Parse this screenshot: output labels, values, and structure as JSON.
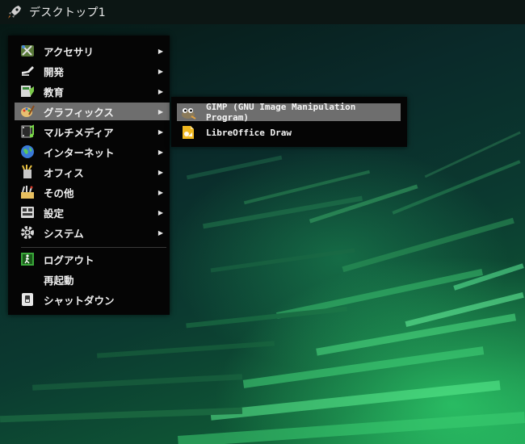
{
  "topbar": {
    "title": "デスクトップ1",
    "icon": "rocket-icon"
  },
  "menu": {
    "items": [
      {
        "label": "アクセサリ",
        "icon": "accessories-icon",
        "arrow": "▶"
      },
      {
        "label": "開発",
        "icon": "development-icon",
        "arrow": "▶"
      },
      {
        "label": "教育",
        "icon": "education-icon",
        "arrow": "▶"
      },
      {
        "label": "グラフィックス",
        "icon": "graphics-icon",
        "arrow": "▶"
      },
      {
        "label": "マルチメディア",
        "icon": "multimedia-icon",
        "arrow": "▶"
      },
      {
        "label": "インターネット",
        "icon": "internet-icon",
        "arrow": "▶"
      },
      {
        "label": "オフィス",
        "icon": "office-icon",
        "arrow": "▶"
      },
      {
        "label": "その他",
        "icon": "other-icon",
        "arrow": "▶"
      },
      {
        "label": "設定",
        "icon": "settings-icon",
        "arrow": "▶"
      },
      {
        "label": "システム",
        "icon": "system-icon",
        "arrow": "▶"
      }
    ],
    "session": [
      {
        "label": "ログアウト",
        "icon": "logout-icon"
      },
      {
        "label": "再起動",
        "icon": ""
      },
      {
        "label": "シャットダウン",
        "icon": "shutdown-icon"
      }
    ]
  },
  "submenu": {
    "items": [
      {
        "label": "GIMP (GNU Image Manipulation Program)",
        "icon": "gimp-icon"
      },
      {
        "label": "LibreOffice Draw",
        "icon": "libreoffice-draw-icon"
      }
    ]
  },
  "colors": {
    "highlight": "#6e6e6e",
    "menu_bg": "#050505",
    "accent_green": "#3cff82"
  }
}
